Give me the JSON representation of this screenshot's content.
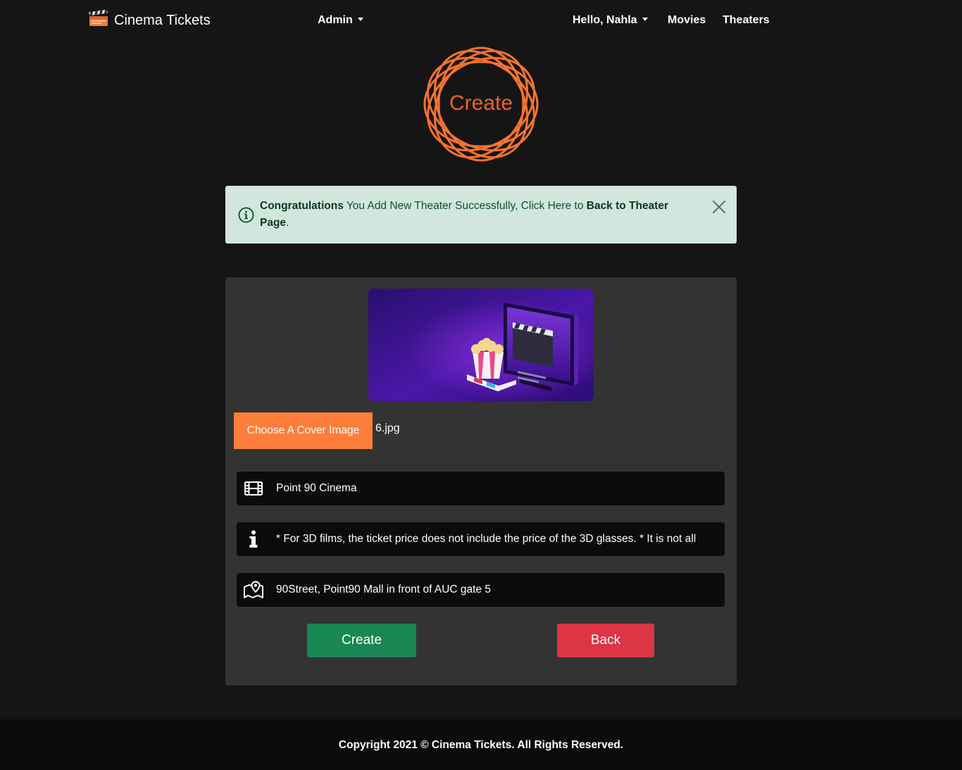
{
  "navbar": {
    "brand": "Cinema Tickets",
    "admin_label": "Admin",
    "user_greeting": "Hello, Nahla",
    "movies_label": "Movies",
    "theaters_label": "Theaters"
  },
  "logo": {
    "text": "Create"
  },
  "alert": {
    "strong_lead": "Congratulations",
    "message": " You Add New Theater Successfully, Click Here to ",
    "link_text": "Back to Theater Page",
    "trailing": "."
  },
  "form": {
    "cover_button_label": "Choose A Cover Image",
    "cover_file_name": "6.jpg",
    "name_value": "Point 90 Cinema",
    "description_value": "* For 3D films, the ticket price does not include the price of the 3D glasses. * It is not all",
    "address_value": "90Street, Point90 Mall in front of AUC gate 5",
    "create_label": "Create",
    "back_label": "Back"
  },
  "footer": {
    "copyright": "Copyright 2021 © Cinema Tickets. All Rights Reserved."
  },
  "colors": {
    "background": "#151515",
    "accent_orange": "#fd7e3b",
    "alert_bg": "#d1e7dd",
    "success": "#198754",
    "danger": "#dc3545",
    "card_bg": "#333333",
    "input_bg": "#0b0b0b"
  },
  "icons": {
    "brand": "clapperboard-icon",
    "alert": "info-circle-icon",
    "alert_close": "close-icon",
    "name_field": "film-icon",
    "description_field": "info-icon",
    "address_field": "map-marker-icon"
  }
}
